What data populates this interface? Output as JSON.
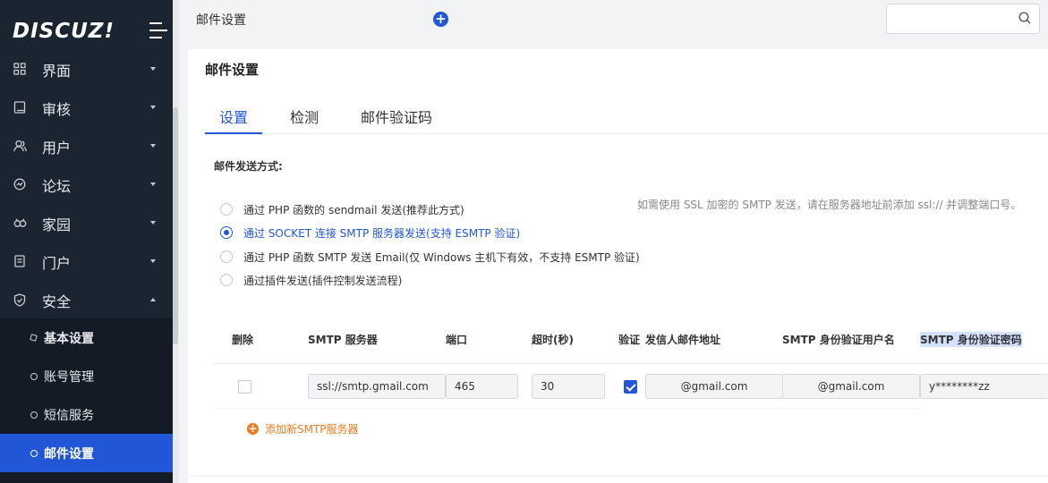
{
  "sidebar": {
    "logo": "DISCUZ!",
    "items": [
      {
        "label": "界面",
        "icon": "grid-icon"
      },
      {
        "label": "审核",
        "icon": "book-icon"
      },
      {
        "label": "用户",
        "icon": "users-icon"
      },
      {
        "label": "论坛",
        "icon": "chat-icon"
      },
      {
        "label": "家园",
        "icon": "community-icon"
      },
      {
        "label": "门户",
        "icon": "document-icon"
      },
      {
        "label": "安全",
        "icon": "shield-icon"
      }
    ],
    "sub_items": [
      {
        "label": "基本设置"
      },
      {
        "label": "账号管理"
      },
      {
        "label": "短信服务"
      },
      {
        "label": "邮件设置"
      }
    ]
  },
  "topbar": {
    "breadcrumb": "邮件设置",
    "search_placeholder": ""
  },
  "card": {
    "title": "邮件设置",
    "tabs": [
      {
        "label": "设置"
      },
      {
        "label": "检测"
      },
      {
        "label": "邮件验证码"
      }
    ],
    "send_method_label": "邮件发送方式:",
    "hint": "如需使用 SSL 加密的 SMTP 发送，请在服务器地址前添加 ssl:// 并调整端口号。",
    "options": [
      {
        "label": "通过 PHP 函数的 sendmail 发送(推荐此方式)",
        "checked": false
      },
      {
        "label": "通过 SOCKET 连接 SMTP 服务器发送(支持 ESMTP 验证)",
        "checked": true
      },
      {
        "label": "通过 PHP 函数 SMTP 发送 Email(仅 Windows 主机下有效，不支持 ESMTP 验证)",
        "checked": false
      },
      {
        "label": "通过插件发送(插件控制发送流程)",
        "checked": false
      }
    ],
    "table": {
      "headers": {
        "delete": "删除",
        "server": "SMTP 服务器",
        "port": "端口",
        "timeout": "超时(秒)",
        "auth": "验证",
        "from": "发信人邮件地址",
        "username": "SMTP 身份验证用户名",
        "password": "SMTP 身份验证密码"
      },
      "row": {
        "delete_checked": false,
        "server": "ssl://smtp.gmail.com",
        "port": "465",
        "timeout": "30",
        "auth_checked": true,
        "from": "@gmail.com",
        "username": "@gmail.com",
        "password": "y********zz"
      }
    },
    "add_label": "添加新SMTP服务器"
  },
  "colors": {
    "accent": "#2156d6",
    "sidebar_bg": "#1b2431",
    "add_orange": "#f07b1e"
  }
}
